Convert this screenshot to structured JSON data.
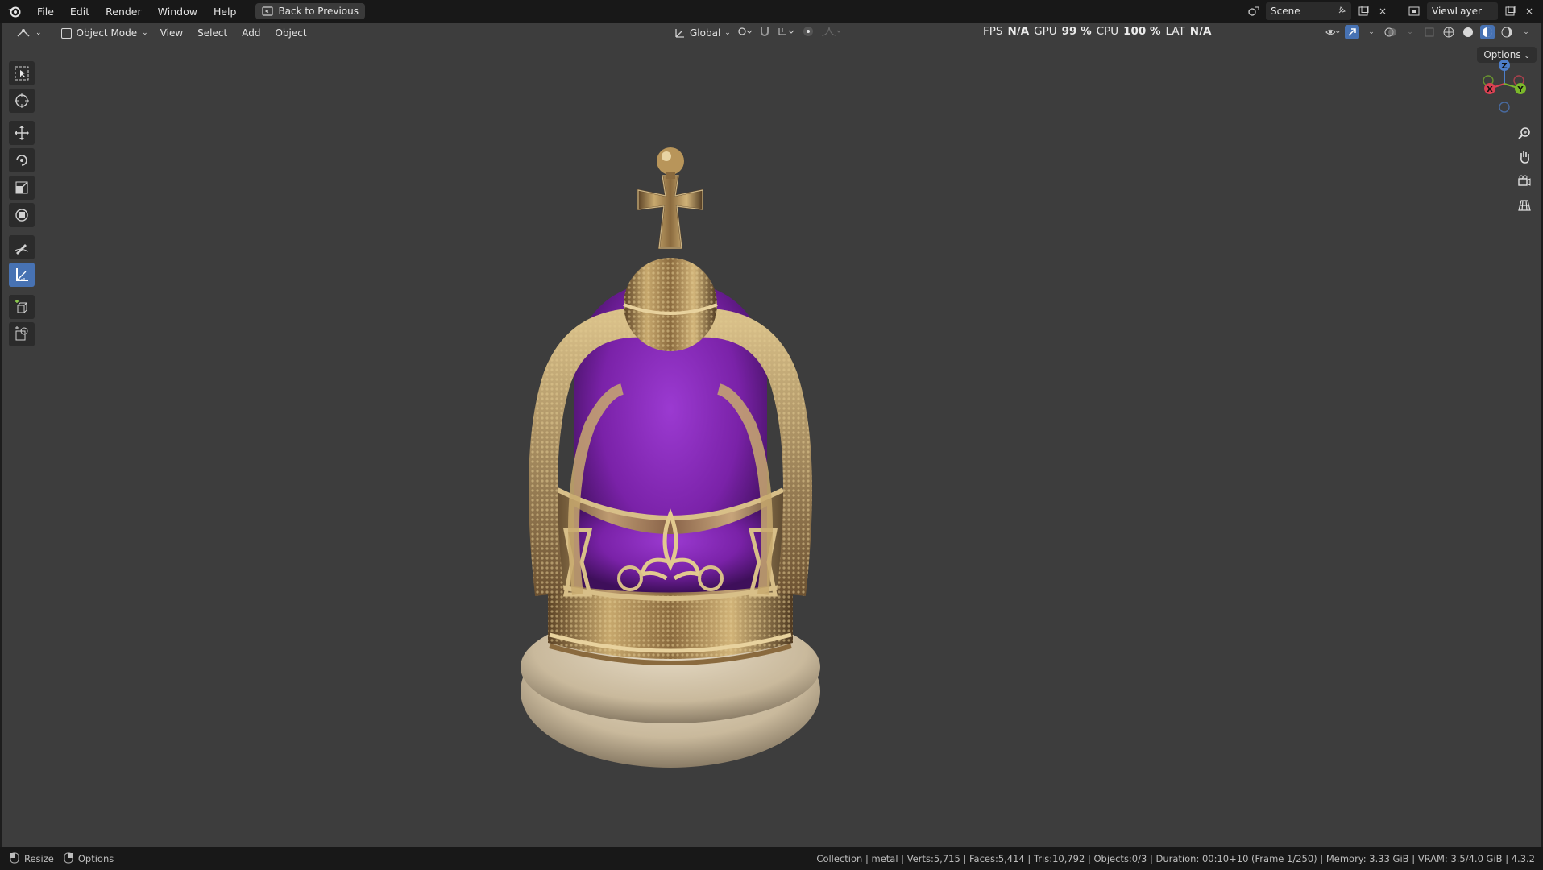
{
  "menu": {
    "items": [
      "File",
      "Edit",
      "Render",
      "Window",
      "Help"
    ],
    "back_button": "Back to Previous"
  },
  "topright": {
    "scene": "Scene",
    "view_layer": "ViewLayer"
  },
  "viewport_header": {
    "mode": "Object Mode",
    "menus": [
      "View",
      "Select",
      "Add",
      "Object"
    ],
    "transform_orientation": "Global"
  },
  "perf": {
    "fps_label": "FPS",
    "fps_value": "N/A",
    "gpu_label": "GPU",
    "gpu_value": "99 %",
    "cpu_label": "CPU",
    "cpu_value": "100 %",
    "lat_label": "LAT",
    "lat_value": "N/A"
  },
  "options_label": "Options",
  "gizmo": {
    "z": "Z",
    "y": "Y",
    "x": "X"
  },
  "toolbar_tools": [
    "select-box",
    "cursor",
    "move",
    "rotate",
    "scale",
    "transform",
    "annotate",
    "measure",
    "add-cube",
    "add-object"
  ],
  "active_tool": "measure",
  "status": {
    "left_resize": "Resize",
    "left_options": "Options",
    "right_text": "Collection | metal | Verts:5,715 | Faces:5,414 | Tris:10,792 | Objects:0/3 | Duration: 00:10+10 (Frame 1/250) | Memory: 3.33 GiB | VRAM: 3.5/4.0 GiB | 4.3.2"
  },
  "colors": {
    "viewport_bg": "#3d3d3d",
    "header_bg": "#181818",
    "accent": "#4772b3",
    "velvet": "#7a22a8",
    "gold": "#b8955a",
    "fur": "#d8cbb4"
  }
}
